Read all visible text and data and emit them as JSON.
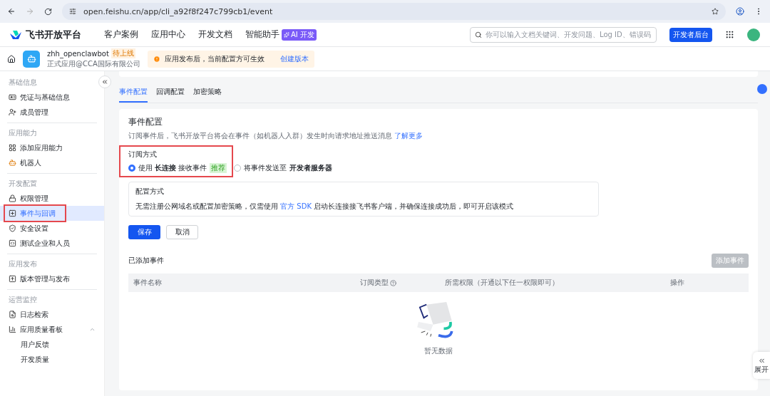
{
  "browser": {
    "url": "open.feishu.cn/app/cli_a92f8f247c799cb1/event"
  },
  "topnav": {
    "brand": "飞书开放平台",
    "links": [
      {
        "label": "客户案例"
      },
      {
        "label": "应用中心"
      },
      {
        "label": "开发文档"
      },
      {
        "label": "智能助手",
        "badge": "AI 开发"
      }
    ],
    "search": {
      "placeholder": "你可以输入文档关键词、开发问题、Log ID、错误码"
    },
    "console_button": "开发者后台"
  },
  "app_header": {
    "name": "zhh_openclawbot",
    "status": "待上线",
    "subtitle": "正式应用@CCA国际有限公司",
    "notice": "应用发布后，当前配置方可生效",
    "notice_link": "创建版本"
  },
  "sidebar": {
    "sections": [
      {
        "title": "基础信息",
        "items": [
          {
            "label": "凭证与基础信息",
            "kind": "card",
            "selected": false,
            "highlighted": false
          },
          {
            "label": "成员管理",
            "kind": "user",
            "selected": false,
            "highlighted": false
          }
        ]
      },
      {
        "title": "应用能力",
        "items": [
          {
            "label": "添加应用能力",
            "kind": "grid",
            "selected": false,
            "highlighted": false
          },
          {
            "label": "机器人",
            "kind": "bot",
            "selected": false,
            "highlighted": false
          }
        ]
      },
      {
        "title": "开发配置",
        "items": [
          {
            "label": "权限管理",
            "kind": "lock",
            "selected": false,
            "highlighted": false
          },
          {
            "label": "事件与回调",
            "kind": "plus",
            "selected": true,
            "highlighted": true
          },
          {
            "label": "安全设置",
            "kind": "shield",
            "selected": false,
            "highlighted": false
          },
          {
            "label": "测试企业和人员",
            "kind": "code",
            "selected": false,
            "highlighted": false
          }
        ]
      },
      {
        "title": "应用发布",
        "items": [
          {
            "label": "版本管理与发布",
            "kind": "upload",
            "selected": false,
            "highlighted": false
          }
        ]
      },
      {
        "title": "运营监控",
        "items": [
          {
            "label": "日志检索",
            "kind": "log",
            "selected": false,
            "highlighted": false
          },
          {
            "label": "应用质量看板",
            "kind": "chart",
            "selected": false,
            "highlighted": false,
            "expanded": true,
            "children": [
              {
                "label": "用户反馈",
                "selected": false
              },
              {
                "label": "开发质量",
                "selected": false
              }
            ]
          }
        ]
      }
    ]
  },
  "tabs": [
    {
      "label": "事件配置",
      "selected": true
    },
    {
      "label": "回调配置",
      "selected": false
    },
    {
      "label": "加密策略",
      "selected": false
    }
  ],
  "event_config": {
    "title": "事件配置",
    "description": "订阅事件后，飞书开放平台将会在事件（如机器人入群）发生时向请求地址推送消息",
    "learn_more": "了解更多",
    "subscription": {
      "label": "订阅方式",
      "highlighted": true,
      "options": [
        {
          "text": "使用 **长连接** 接收事件",
          "tag": "推荐",
          "selected": true
        },
        {
          "text": "将事件发送至 **开发者服务器**",
          "selected": false
        }
      ]
    },
    "method": {
      "title": "配置方式",
      "before": "无需注册公网域名或配置加密策略，仅需使用",
      "link": "官方 SDK",
      "after": "启动长连接接飞书客户端，并确保连接成功后，即可开启该模式"
    },
    "buttons": [
      {
        "label": "保存",
        "kind": "primary"
      },
      {
        "label": "取消",
        "kind": "default"
      }
    ]
  },
  "added_events": {
    "title": "已添加事件",
    "add_button": {
      "label": "添加事件",
      "disabled": true
    },
    "columns": [
      {
        "label": "事件名称",
        "help": false
      },
      {
        "label": "订阅类型",
        "help": true
      },
      {
        "label": "所需权限（开通以下任一权限即可）",
        "help": false
      },
      {
        "label": "操作",
        "help": false
      }
    ],
    "empty": "暂无数据"
  },
  "side_tab": {
    "label": "展开"
  }
}
